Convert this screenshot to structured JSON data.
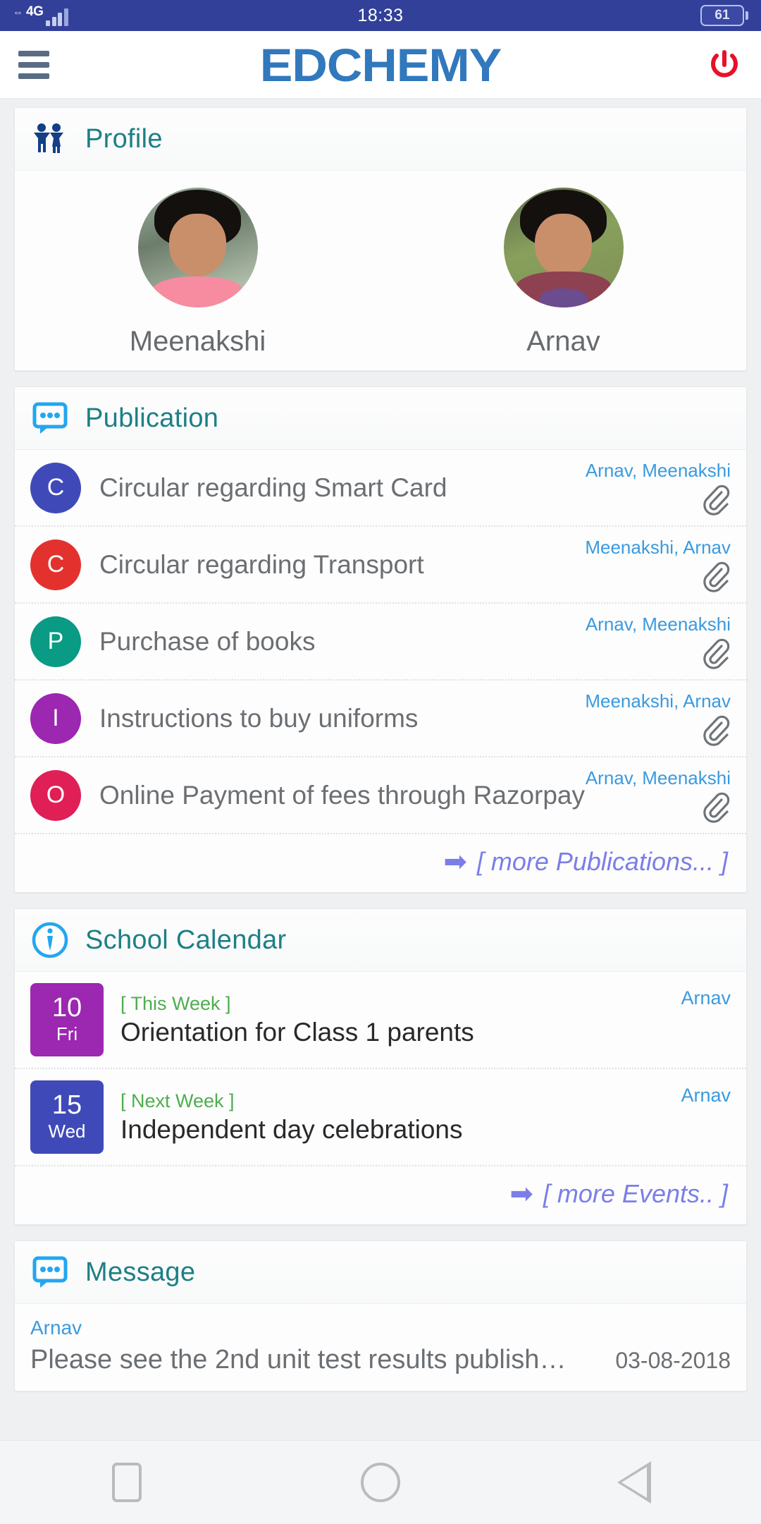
{
  "status_bar": {
    "network": "4G",
    "time": "18:33",
    "battery": "61"
  },
  "header": {
    "brand": "EDCHEMY",
    "menu_icon": "hamburger-menu-icon",
    "power_icon": "power-logout-icon"
  },
  "profile": {
    "title": "Profile",
    "icon": "children-group-icon",
    "students": [
      {
        "name": "Meenakshi"
      },
      {
        "name": "Arnav"
      }
    ]
  },
  "publication": {
    "title": "Publication",
    "icon": "speech-bubble-icon",
    "items": [
      {
        "initial": "C",
        "color": "#3f4ab8",
        "title": "Circular regarding Smart Card",
        "students": "Arnav, Meenakshi",
        "attachment": "paperclip-icon"
      },
      {
        "initial": "C",
        "color": "#e3322d",
        "title": "Circular regarding Transport",
        "students": "Meenakshi, Arnav",
        "attachment": "paperclip-icon"
      },
      {
        "initial": "P",
        "color": "#099b83",
        "title": "Purchase of books",
        "students": "Arnav, Meenakshi",
        "attachment": "paperclip-icon"
      },
      {
        "initial": "I",
        "color": "#9c27b0",
        "title": "Instructions to buy uniforms",
        "students": "Meenakshi, Arnav",
        "attachment": "paperclip-icon"
      },
      {
        "initial": "O",
        "color": "#e01f56",
        "title": "Online Payment of fees through Razorpay",
        "students": "Arnav, Meenakshi",
        "attachment": "paperclip-icon"
      }
    ],
    "more_label": "[ more Publications... ]",
    "more_arrow": "➡"
  },
  "school_calendar": {
    "title": "School Calendar",
    "icon": "info-circle-icon",
    "events": [
      {
        "day": "10",
        "dow": "Fri",
        "color": "#9c27b0",
        "week": "[ This Week ]",
        "title": "Orientation for Class 1 parents",
        "student": "Arnav"
      },
      {
        "day": "15",
        "dow": "Wed",
        "color": "#3f4ab8",
        "week": "[ Next Week ]",
        "title": "Independent day celebrations",
        "student": "Arnav"
      }
    ],
    "more_label": "[ more Events.. ]",
    "more_arrow": "➡"
  },
  "message": {
    "title": "Message",
    "icon": "speech-bubble-icon",
    "items": [
      {
        "from": "Arnav",
        "text": "Please see the 2nd unit test results publish…",
        "date": "03-08-2018"
      }
    ]
  },
  "navigation": {
    "recent_label": "recent-apps",
    "home_label": "home",
    "back_label": "back"
  }
}
